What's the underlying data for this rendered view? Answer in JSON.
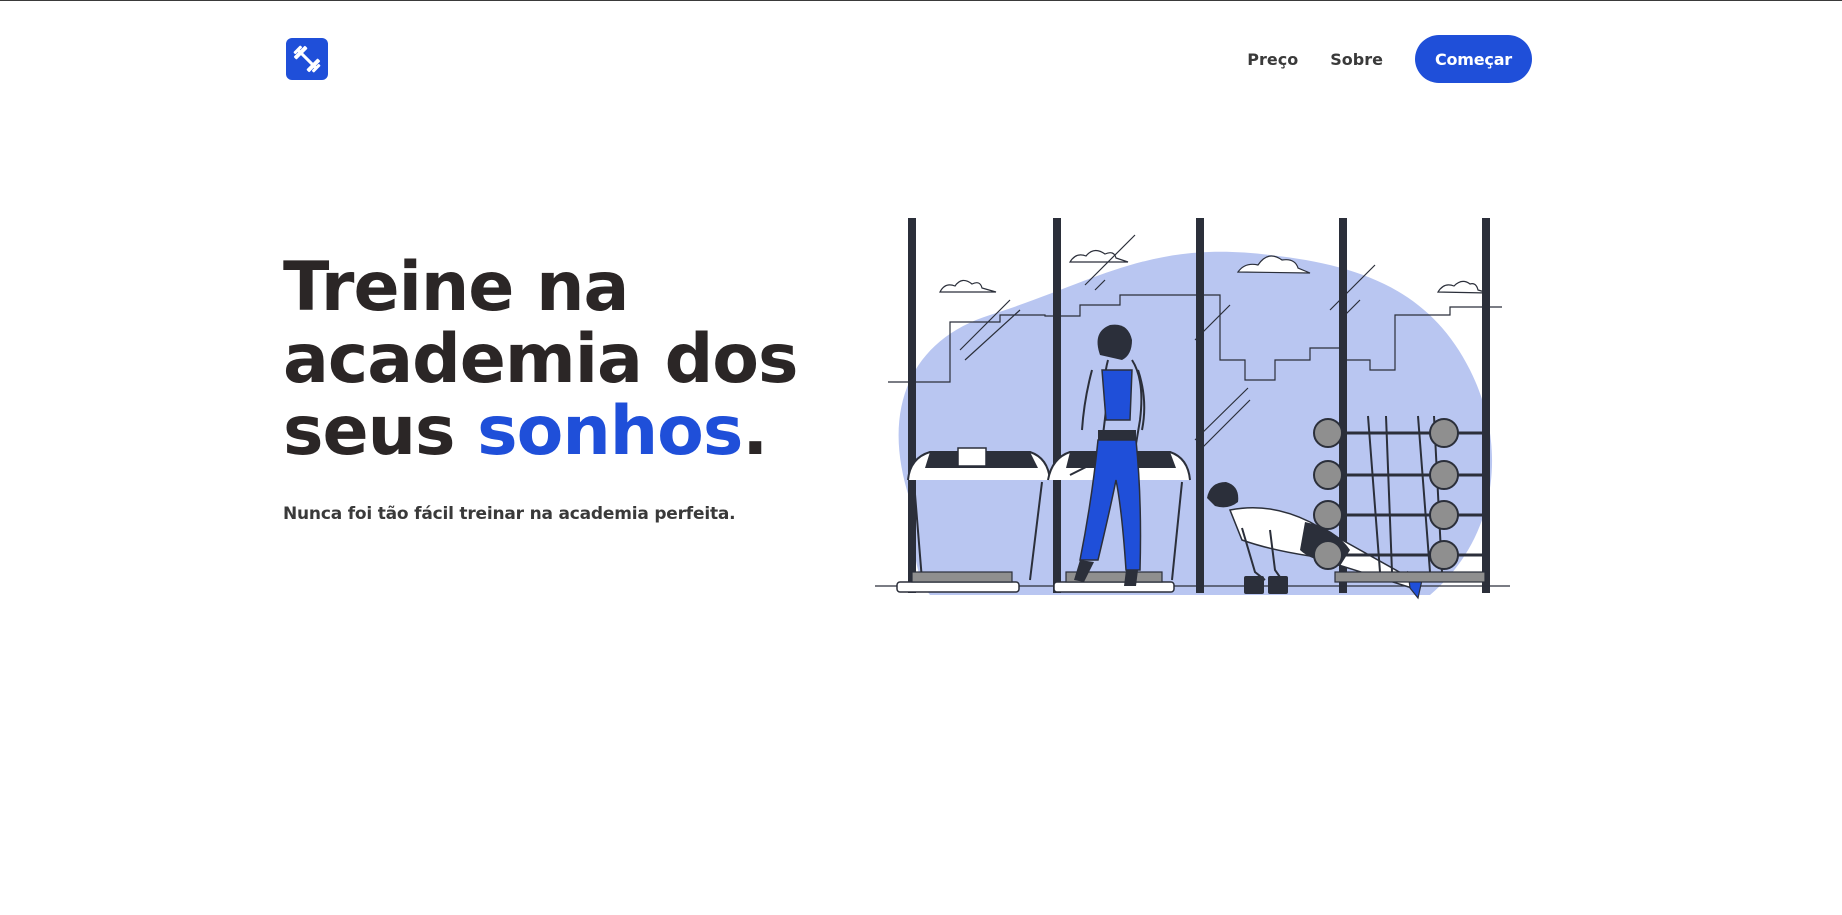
{
  "header": {
    "logo_icon": "dumbbell-icon",
    "nav": {
      "items": [
        {
          "label": "Preço"
        },
        {
          "label": "Sobre"
        }
      ],
      "cta_label": "Começar"
    }
  },
  "hero": {
    "headline_line1": "Treine na",
    "headline_line2": "academia dos",
    "headline_line3_start": "seus",
    "headline_accent": "sonhos",
    "headline_end": ".",
    "subtitle": "Nunca foi tão fácil treinar na academia perfeita."
  },
  "illustration": {
    "name": "gym-illustration-icon"
  },
  "colors": {
    "accent": "#1f4fd9",
    "text": "#2b2626",
    "blob": "#b9c6f1"
  }
}
